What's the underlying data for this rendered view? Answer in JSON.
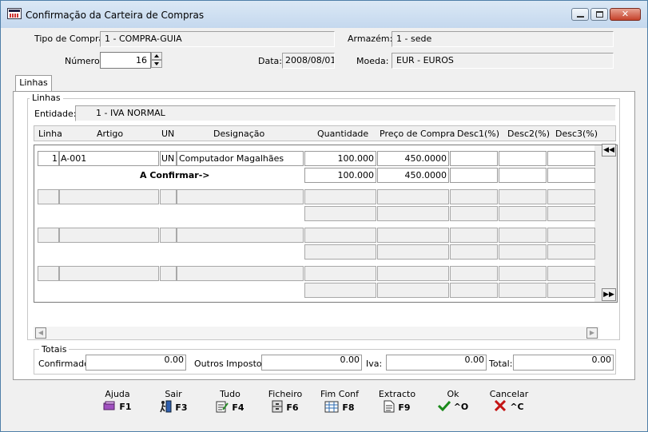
{
  "window": {
    "title": "Confirmação da Carteira de Compras"
  },
  "header": {
    "tipo_compra_label": "Tipo de Compra:",
    "tipo_compra_value": "1 - COMPRA-GUIA",
    "armazem_label": "Armazém:",
    "armazem_value": "1 - sede",
    "numero_label": "Número:",
    "numero_value": "16",
    "data_label": "Data:",
    "data_value": "2008/08/01",
    "moeda_label": "Moeda:",
    "moeda_value": "EUR - EUROS"
  },
  "tabs": [
    {
      "label": "Linhas"
    }
  ],
  "linhas": {
    "group_title": "Linhas",
    "entidade_label": "Entidade:",
    "entidade_value": "1 - IVA NORMAL",
    "columns": [
      "Linha",
      "Artigo",
      "UN",
      "Designação",
      "Quantidade",
      "Preço de Compra",
      "Desc1(%)",
      "Desc2(%)",
      "Desc3(%)"
    ],
    "rows": [
      {
        "linha": "1",
        "artigo": "A-001",
        "un": "UN",
        "designacao": "Computador Magalhães",
        "quantidade": "100.000",
        "preco": "450.0000"
      },
      {
        "confirm_label": "A Confirmar->",
        "quantidade": "100.000",
        "preco": "450.0000"
      }
    ],
    "scroll_up": "◀◀",
    "scroll_down": "▶▶"
  },
  "totais": {
    "title": "Totais",
    "confirmado_label": "Confirmado:",
    "confirmado_value": "0.00",
    "outros_label": "Outros Impostos:",
    "outros_value": "0.00",
    "iva_label": "Iva:",
    "iva_value": "0.00",
    "total_label": "Total:",
    "total_value": "0.00"
  },
  "toolbar": [
    {
      "label": "Ajuda",
      "key": "F1",
      "icon": "book-icon"
    },
    {
      "label": "Sair",
      "key": "F3",
      "icon": "exit-icon"
    },
    {
      "label": "Tudo",
      "key": "F4",
      "icon": "notepad-icon"
    },
    {
      "label": "Ficheiro",
      "key": "F6",
      "icon": "cabinet-icon"
    },
    {
      "label": "Fim Conf",
      "key": "F8",
      "icon": "ledger-icon"
    },
    {
      "label": "Extracto",
      "key": "F9",
      "icon": "document-icon"
    },
    {
      "label": "Ok",
      "key": "^O",
      "icon": "check-icon"
    },
    {
      "label": "Cancelar",
      "key": "^C",
      "icon": "cross-icon"
    }
  ],
  "colors": {
    "check": "#1a8a1a",
    "cross": "#c41414",
    "title_bg": "#c4d8ee"
  }
}
